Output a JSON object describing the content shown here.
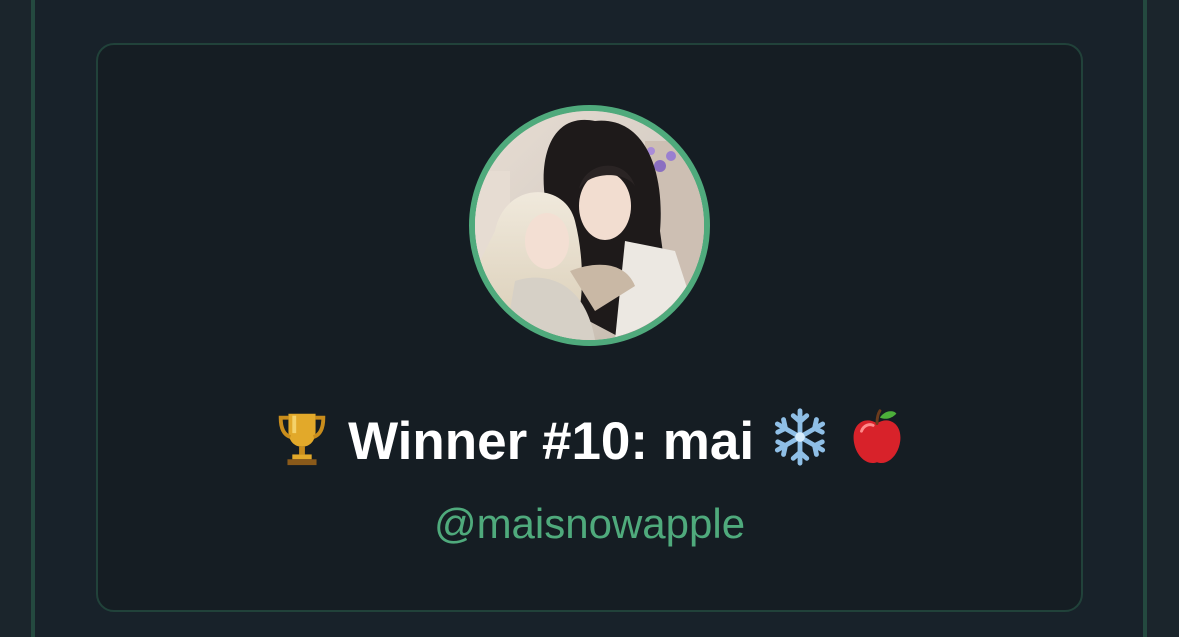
{
  "card": {
    "trophy_icon": "trophy-icon",
    "title": "Winner #10: mai",
    "snowflake_icon": "snowflake-icon",
    "apple_icon": "apple-icon",
    "handle": "@maisnowapple"
  },
  "colors": {
    "accent": "#4faa7c",
    "background": "#1b252c",
    "card_background": "#151d23",
    "card_border": "#21423a",
    "title_text": "#ffffff"
  }
}
